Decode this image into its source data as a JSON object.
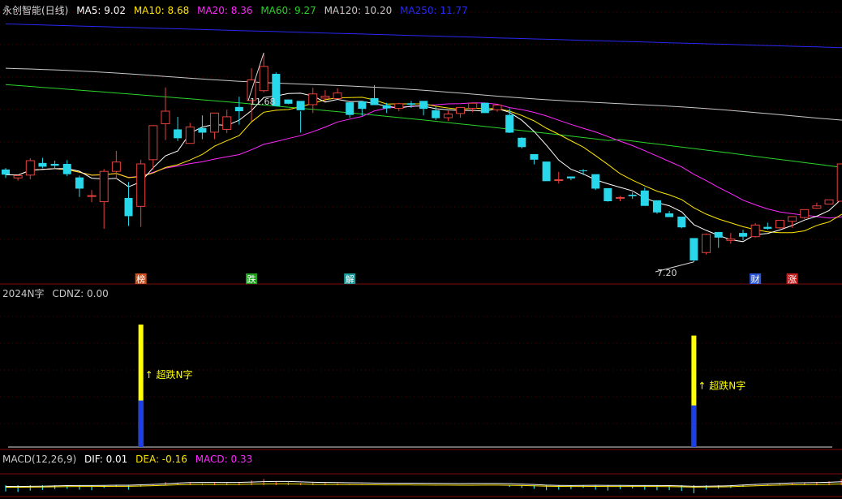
{
  "colors": {
    "bg": "#000000",
    "up": "#e8413c",
    "down": "#28d8ea",
    "ma5": "#ffffff",
    "ma10": "#ffe600",
    "ma20": "#ff28ff",
    "ma60": "#2ad42a",
    "ma120": "#c8c8c8",
    "ma250": "#2828f0",
    "grid": "#8a1010",
    "signal_yellow": "#ffff00",
    "signal_blue": "#1a3ef0"
  },
  "main_header": {
    "stock_name": "永创智能(日线)",
    "ma5": "MA5: 9.02",
    "ma10": "MA10: 8.68",
    "ma20": "MA20: 8.36",
    "ma60": "MA60: 9.27",
    "ma120": "MA120: 10.20",
    "ma250": "MA250: 11.77"
  },
  "sub_header": {
    "name": "2024N字",
    "value": "CDNZ: 0.00"
  },
  "macd_header": {
    "name": "MACD(12,26,9)",
    "dif": "DIF: 0.01",
    "dea": "DEA: -0.16",
    "macd": "MACD: 0.33"
  },
  "annotations": {
    "high_label": "11.68",
    "low_label": "7.20",
    "event_markers": [
      "榜",
      "跌",
      "解",
      "财",
      "涨"
    ],
    "signal_label": "超跌N字"
  },
  "chart_data": {
    "type": "candlestick",
    "y_range": [
      6.9,
      12.5
    ],
    "ohlc": [
      [
        9.18,
        9.21,
        9.0,
        9.07
      ],
      [
        9.0,
        9.06,
        8.94,
        9.05
      ],
      [
        9.06,
        9.42,
        8.97,
        9.37
      ],
      [
        9.32,
        9.43,
        9.21,
        9.24
      ],
      [
        9.3,
        9.37,
        9.19,
        9.26
      ],
      [
        9.3,
        9.38,
        9.04,
        9.08
      ],
      [
        9.01,
        9.05,
        8.59,
        8.77
      ],
      [
        8.62,
        8.74,
        8.48,
        8.62
      ],
      [
        8.49,
        9.19,
        7.91,
        9.14
      ],
      [
        9.14,
        9.58,
        8.97,
        9.34
      ],
      [
        8.57,
        8.91,
        7.97,
        8.18
      ],
      [
        8.39,
        9.39,
        7.95,
        9.3
      ],
      [
        9.39,
        10.13,
        9.18,
        10.12
      ],
      [
        10.16,
        10.94,
        9.81,
        10.43
      ],
      [
        10.04,
        10.31,
        9.79,
        9.85
      ],
      [
        9.74,
        10.18,
        9.75,
        10.09
      ],
      [
        10.07,
        10.34,
        9.83,
        9.97
      ],
      [
        9.98,
        10.39,
        9.83,
        10.39
      ],
      [
        10.04,
        10.46,
        9.96,
        10.31
      ],
      [
        10.52,
        10.74,
        10.14,
        10.43
      ],
      [
        10.66,
        11.35,
        10.21,
        11.1
      ],
      [
        10.87,
        11.68,
        10.83,
        11.39
      ],
      [
        11.23,
        11.26,
        10.55,
        10.54
      ],
      [
        10.68,
        10.68,
        10.58,
        10.59
      ],
      [
        10.65,
        10.43,
        9.97,
        10.45
      ],
      [
        10.57,
        10.93,
        10.39,
        10.8
      ],
      [
        10.71,
        10.88,
        10.64,
        10.75
      ],
      [
        10.7,
        10.92,
        10.69,
        10.82
      ],
      [
        10.62,
        10.57,
        10.29,
        10.35
      ],
      [
        10.64,
        10.63,
        10.33,
        10.48
      ],
      [
        10.71,
        10.99,
        10.61,
        10.56
      ],
      [
        10.56,
        10.61,
        10.39,
        10.49
      ],
      [
        10.49,
        10.61,
        10.43,
        10.59
      ],
      [
        10.6,
        10.65,
        10.5,
        10.57
      ],
      [
        10.65,
        10.56,
        10.34,
        10.48
      ],
      [
        10.45,
        10.53,
        10.24,
        10.28
      ],
      [
        10.29,
        10.44,
        10.22,
        10.37
      ],
      [
        10.38,
        10.52,
        10.29,
        10.51
      ],
      [
        10.49,
        10.52,
        10.41,
        10.6
      ],
      [
        10.61,
        10.43,
        10.39,
        10.39
      ],
      [
        10.46,
        10.57,
        10.42,
        10.56
      ],
      [
        10.35,
        10.49,
        9.96,
        9.97
      ],
      [
        9.86,
        9.87,
        9.63,
        9.66
      ],
      [
        9.51,
        9.49,
        9.29,
        9.39
      ],
      [
        9.35,
        9.28,
        8.93,
        8.93
      ],
      [
        8.95,
        9.13,
        8.88,
        8.96
      ],
      [
        9.03,
        9.03,
        8.95,
        8.99
      ],
      [
        9.16,
        9.19,
        9.06,
        9.15
      ],
      [
        9.08,
        8.99,
        8.74,
        8.77
      ],
      [
        8.78,
        8.73,
        8.49,
        8.5
      ],
      [
        8.58,
        8.61,
        8.5,
        8.58
      ],
      [
        8.64,
        8.69,
        8.55,
        8.61
      ],
      [
        8.73,
        8.79,
        8.46,
        8.4
      ],
      [
        8.52,
        8.47,
        8.23,
        8.26
      ],
      [
        8.24,
        8.29,
        8.17,
        8.16
      ],
      [
        8.17,
        8.12,
        7.92,
        7.94
      ],
      [
        7.71,
        7.53,
        7.2,
        7.23
      ],
      [
        7.4,
        7.81,
        7.36,
        7.79
      ],
      [
        7.84,
        7.84,
        7.5,
        7.72
      ],
      [
        7.66,
        7.82,
        7.59,
        7.69
      ],
      [
        7.82,
        7.89,
        7.66,
        7.74
      ],
      [
        7.74,
        8.03,
        7.72,
        7.99
      ],
      [
        7.95,
        8.04,
        7.89,
        7.91
      ],
      [
        7.93,
        7.96,
        7.91,
        8.09
      ],
      [
        8.07,
        8.14,
        7.93,
        8.17
      ],
      [
        8.15,
        8.32,
        8.12,
        8.32
      ],
      [
        8.35,
        8.47,
        8.34,
        8.4
      ],
      [
        8.44,
        8.44,
        8.47,
        8.53
      ],
      [
        8.5,
        9.31,
        8.6,
        9.3
      ],
      [
        9.04,
        9.19,
        8.86,
        8.85
      ],
      [
        8.97,
        9.06,
        8.97,
        9.03
      ],
      [
        8.88,
        8.96,
        8.81,
        9.02
      ]
    ],
    "high": 11.68,
    "low": 7.2,
    "ma_last": {
      "MA5": 9.02,
      "MA10": 8.68,
      "MA20": 8.36,
      "MA60": 9.27,
      "MA120": 10.2,
      "MA250": 11.77
    },
    "signals": [
      {
        "bar": 11,
        "yellow": 1.0,
        "blue": 0.38
      },
      {
        "bar": 56,
        "yellow": 0.91,
        "blue": 0.34
      }
    ],
    "macd_bars": [
      -0.35,
      -0.38,
      -0.3,
      -0.27,
      -0.22,
      -0.2,
      -0.25,
      -0.28,
      -0.15,
      -0.1,
      -0.25,
      -0.08,
      0.05,
      0.18,
      0.12,
      0.15,
      0.1,
      0.16,
      0.15,
      0.18,
      0.28,
      0.35,
      0.22,
      0.18,
      0.12,
      0.15,
      0.12,
      0.1,
      0.05,
      0.06,
      0.05,
      0.04,
      0.05,
      0.04,
      0.02,
      -0.02,
      0.0,
      0.02,
      0.03,
      0.0,
      0.02,
      -0.1,
      -0.15,
      -0.2,
      -0.28,
      -0.25,
      -0.22,
      -0.15,
      -0.25,
      -0.3,
      -0.22,
      -0.18,
      -0.25,
      -0.28,
      -0.28,
      -0.32,
      -0.45,
      -0.25,
      -0.2,
      -0.15,
      -0.1,
      0.05,
      0.05,
      0.08,
      0.1,
      0.15,
      0.18,
      0.22,
      0.35,
      0.3,
      0.33,
      0.33
    ]
  }
}
